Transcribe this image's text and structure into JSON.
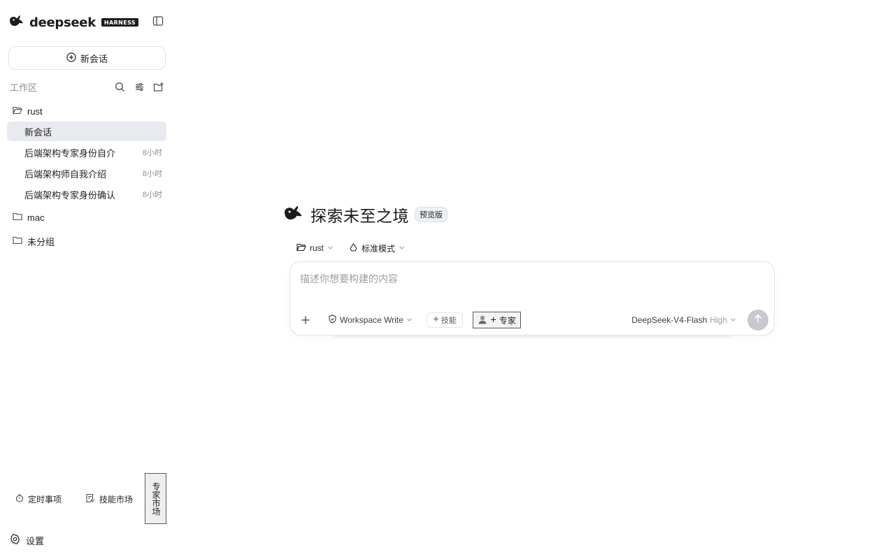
{
  "brand": {
    "name": "deepseek",
    "badge": "HARNESS"
  },
  "sidebar": {
    "new_chat_label": "新会话",
    "workspace_title": "工作区",
    "folders": [
      {
        "name": "rust",
        "chats": [
          {
            "title": "新会话",
            "time": "",
            "active": true
          },
          {
            "title": "后端架构专家身份自介",
            "time": "8小时"
          },
          {
            "title": "后端架构师自我介绍",
            "time": "8小时"
          },
          {
            "title": "后端架构专家身份确认",
            "time": "8小时"
          }
        ]
      },
      {
        "name": "mac"
      },
      {
        "name": "未分组"
      }
    ],
    "bottom": {
      "scheduled": "定时事项",
      "skill_market": "技能市场",
      "expert_market": "专家市场",
      "settings": "设置"
    }
  },
  "main": {
    "hero_title": "探索未至之境",
    "preview_badge": "预览版",
    "context": {
      "workspace": "rust",
      "mode": "标准模式"
    },
    "composer": {
      "placeholder": "描述你想要构建的内容",
      "permission": "Workspace Write",
      "skill_label": "技能",
      "expert_label": "专家",
      "model": "DeepSeek-V4-Flash",
      "level": "High"
    }
  },
  "icons": {
    "logo": "whale-icon",
    "sidebar_toggle": "sidebar-toggle-icon",
    "new_chat": "plus-circle-icon",
    "search": "search-icon",
    "filter": "sliders-icon",
    "new_folder": "folder-plus-icon",
    "folder_open": "folder-open-icon",
    "folder": "folder-icon",
    "timer": "timer-icon",
    "skill_market": "note-icon",
    "settings": "gear-icon",
    "mode": "recycle-icon",
    "permission": "shield-icon",
    "send": "arrow-up-icon"
  },
  "colors": {
    "accent_active": "#e8eaef",
    "send_disabled": "#c7c9ce",
    "text": "#1f1f1f",
    "muted": "#8a8d94"
  }
}
